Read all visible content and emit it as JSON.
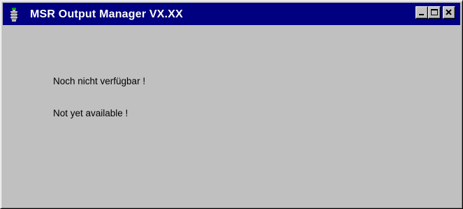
{
  "window": {
    "title": "MSR Output Manager VX.XX",
    "app_icon": "app-icon",
    "controls": {
      "minimize": "minimize-icon",
      "maximize": "maximize-icon",
      "close": "close-icon"
    }
  },
  "content": {
    "message_de": "Noch nicht verfügbar !",
    "message_en": "Not yet available !"
  },
  "colors": {
    "titlebar": "#000080",
    "title_text": "#ffffff",
    "window_bg": "#c0c0c0",
    "text": "#000000"
  }
}
